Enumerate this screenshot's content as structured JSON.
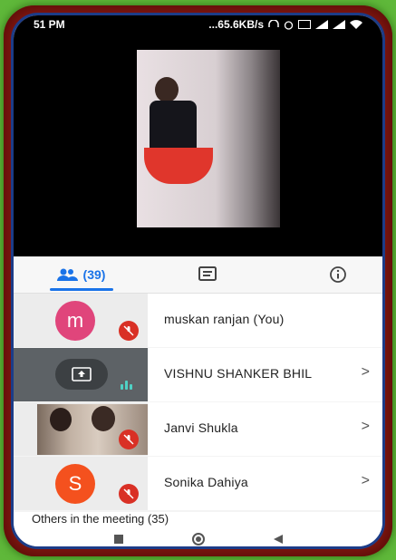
{
  "status_bar": {
    "time": "51 PM",
    "network_speed": "...65.6KB/s",
    "icons": [
      "headset-icon",
      "alarm-icon",
      "volte-icon",
      "signal-icon",
      "signal-icon",
      "wifi-icon"
    ]
  },
  "tabs": {
    "people_count": "(39)",
    "active": "people"
  },
  "participants": [
    {
      "avatar_letter": "m",
      "avatar_color": "#e0457b",
      "name": "muskan ranjan (You)",
      "muted": true,
      "chevron": false
    },
    {
      "avatar_type": "presenting",
      "name": "VISHNU SHANKER BHIL",
      "muted": false,
      "speaking": true,
      "chevron": true
    },
    {
      "avatar_type": "video",
      "name": "Janvi Shukla",
      "muted": true,
      "chevron": true
    },
    {
      "avatar_letter": "S",
      "avatar_color": "#f4511e",
      "name": "Sonika Dahiya",
      "muted": true,
      "chevron": true
    }
  ],
  "others_label": "Others in the meeting (35)",
  "chevron_glyph": ">",
  "colors": {
    "accent": "#1a73e8",
    "mute_red": "#d93025"
  }
}
